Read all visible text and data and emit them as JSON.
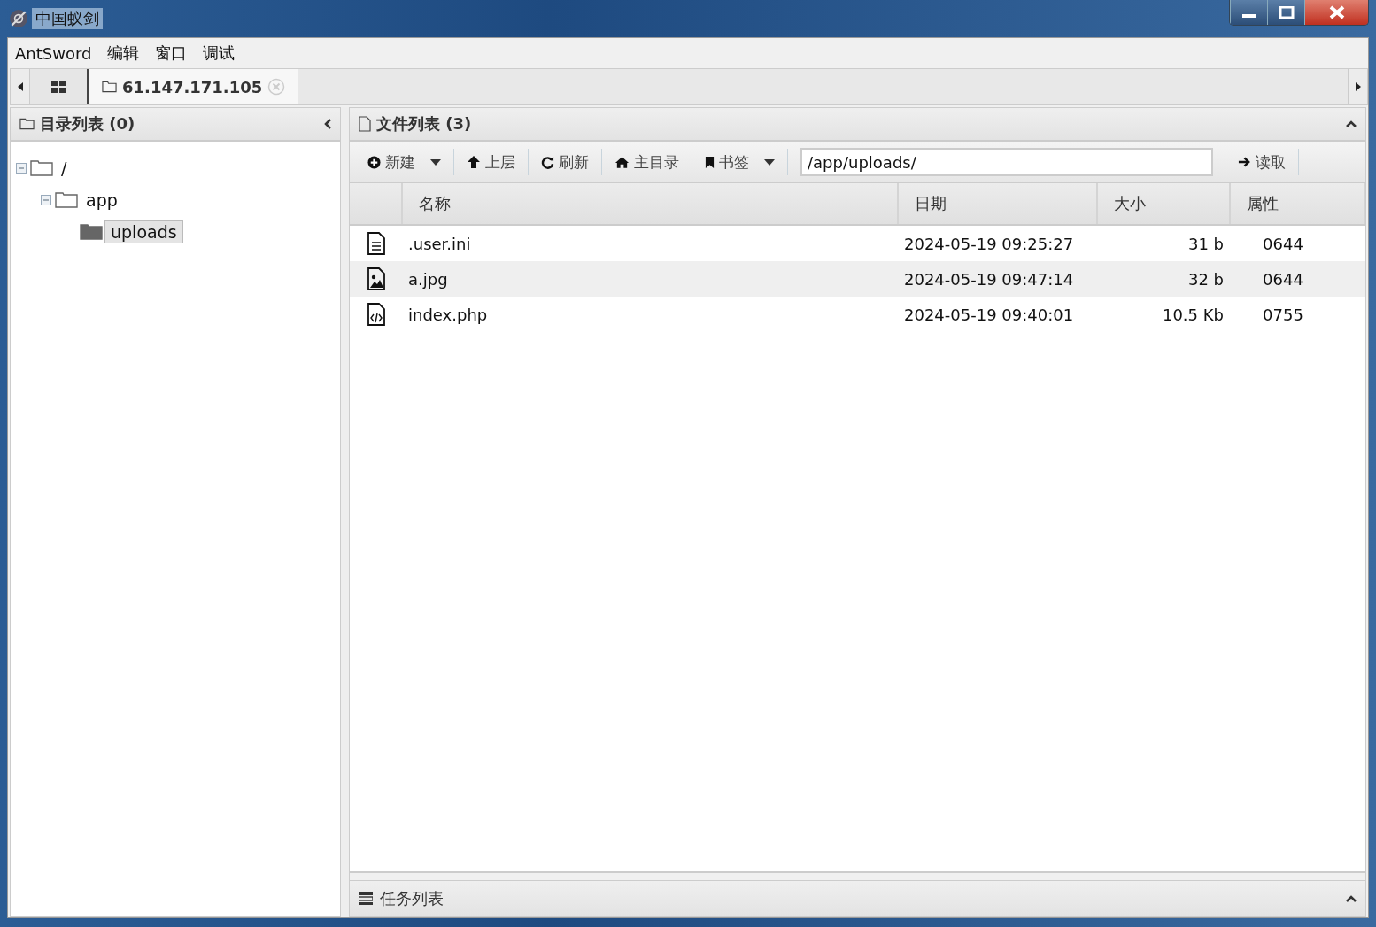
{
  "window": {
    "title": "中国蚁剑"
  },
  "menu": [
    "AntSword",
    "编辑",
    "窗口",
    "调试"
  ],
  "tabs": [
    {
      "kind": "home",
      "selected": false
    },
    {
      "kind": "host",
      "label": "61.147.171.105",
      "selected": true
    }
  ],
  "dir_panel": {
    "title": "目录列表 (0)",
    "tree": [
      {
        "label": "/",
        "expanded": true,
        "selected": false,
        "children": [
          {
            "label": "app",
            "expanded": true,
            "selected": false,
            "children": [
              {
                "label": "uploads",
                "expanded": false,
                "selected": true
              }
            ]
          }
        ]
      }
    ]
  },
  "file_panel": {
    "title": "文件列表 (3)",
    "toolbar": [
      {
        "kind": "new",
        "label": "新建",
        "dropdown": true
      },
      {
        "kind": "up",
        "label": "上层",
        "dropdown": false
      },
      {
        "kind": "refresh",
        "label": "刷新",
        "dropdown": false
      },
      {
        "kind": "home",
        "label": "主目录",
        "dropdown": false
      },
      {
        "kind": "bookmark",
        "label": "书签",
        "dropdown": true
      }
    ],
    "path": {
      "value": "/app/uploads/"
    },
    "read_button": "读取",
    "columns": [
      "名称",
      "日期",
      "大小",
      "属性"
    ],
    "rows": [
      {
        "kind": "text",
        "name": ".user.ini",
        "date": "2024-05-19 09:25:27",
        "size": "31 b",
        "perm": "0644",
        "selected": false
      },
      {
        "kind": "image",
        "name": "a.jpg",
        "date": "2024-05-19 09:47:14",
        "size": "32 b",
        "perm": "0644",
        "selected": true
      },
      {
        "kind": "code",
        "name": "index.php",
        "date": "2024-05-19 09:40:01",
        "size": "10.5 Kb",
        "perm": "0755",
        "selected": false
      }
    ]
  },
  "task_panel": {
    "title": "任务列表"
  }
}
